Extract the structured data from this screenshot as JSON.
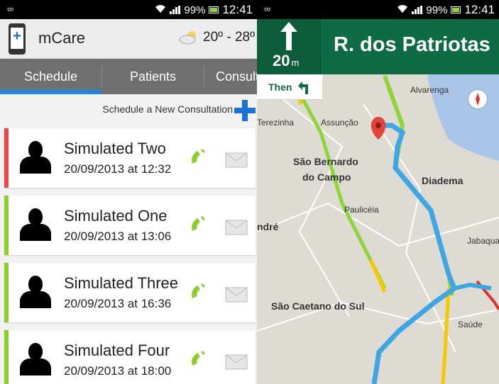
{
  "status": {
    "battery": "99%",
    "time": "12:41"
  },
  "app": {
    "title": "mCare",
    "temperature": "20º - 28º"
  },
  "tabs": [
    {
      "label": "Schedule",
      "selected": true
    },
    {
      "label": "Patients",
      "selected": false
    },
    {
      "label": "Consultations",
      "selected": false
    }
  ],
  "new_consultation_label": "Schedule a New Consultation",
  "consultations": [
    {
      "name": "Simulated Two",
      "date": "20/09/2013 at 12:32",
      "status_color": "#f0474a"
    },
    {
      "name": "Simulated One",
      "date": "20/09/2013 at 13:06",
      "status_color": "#8ccf2b"
    },
    {
      "name": "Simulated Three",
      "date": "20/09/2013 at 16:36",
      "status_color": "#8ccf2b"
    },
    {
      "name": "Simulated Four",
      "date": "20/09/2013 at 18:00",
      "status_color": "#8ccf2b"
    }
  ],
  "navigation": {
    "distance": "20",
    "distance_unit": "m",
    "street": "R. dos Patriotas",
    "then_label": "Then"
  },
  "map_labels": {
    "alvarenga": "Alvarenga",
    "terezinha": "Terezinha",
    "assuncao": "Assunção",
    "sao_bernardo": "São Bernardo",
    "do_campo": "do Campo",
    "diadema": "Diadema",
    "pauliceia": "Paulicéia",
    "andre": "ndré",
    "jabaqu": "Jabaqua",
    "sao_caetano": "São Caetano do Sul",
    "saude": "Saúde"
  },
  "colors": {
    "accent": "#1e88e5",
    "nav_green": "#0e6b44",
    "route_blue": "#3fa6e6"
  }
}
